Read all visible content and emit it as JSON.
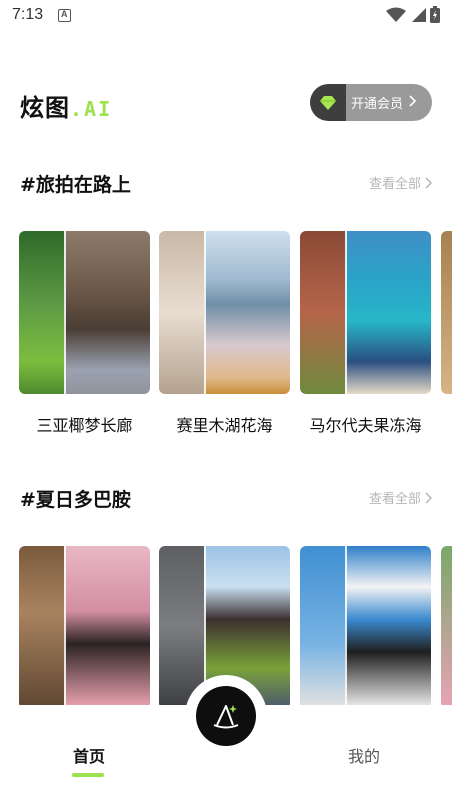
{
  "status_bar": {
    "time": "7:13",
    "notification_icon": "a-badge-icon",
    "icons": [
      "wifi-icon",
      "signal-icon",
      "battery-icon"
    ]
  },
  "header": {
    "logo_cn": "炫图",
    "logo_ai": ".AI",
    "vip_label": "开通会员",
    "vip_icon": "diamond-icon"
  },
  "sections": [
    {
      "title": "#旅拍在路上",
      "see_all": "查看全部",
      "cards": [
        {
          "caption": "三亚椰梦长廊"
        },
        {
          "caption": "赛里木湖花海"
        },
        {
          "caption": "马尔代夫果冻海"
        }
      ]
    },
    {
      "title": "#夏日多巴胺",
      "see_all": "查看全部",
      "cards": [
        {
          "caption": ""
        },
        {
          "caption": ""
        },
        {
          "caption": ""
        }
      ]
    }
  ],
  "tabbar": {
    "home": "首页",
    "mine": "我的",
    "center_icon": "wizard-hat-icon"
  },
  "colors": {
    "accent": "#9ce24f",
    "vip_bg": "#9a9a9a",
    "vip_left": "#3e3e3e"
  }
}
